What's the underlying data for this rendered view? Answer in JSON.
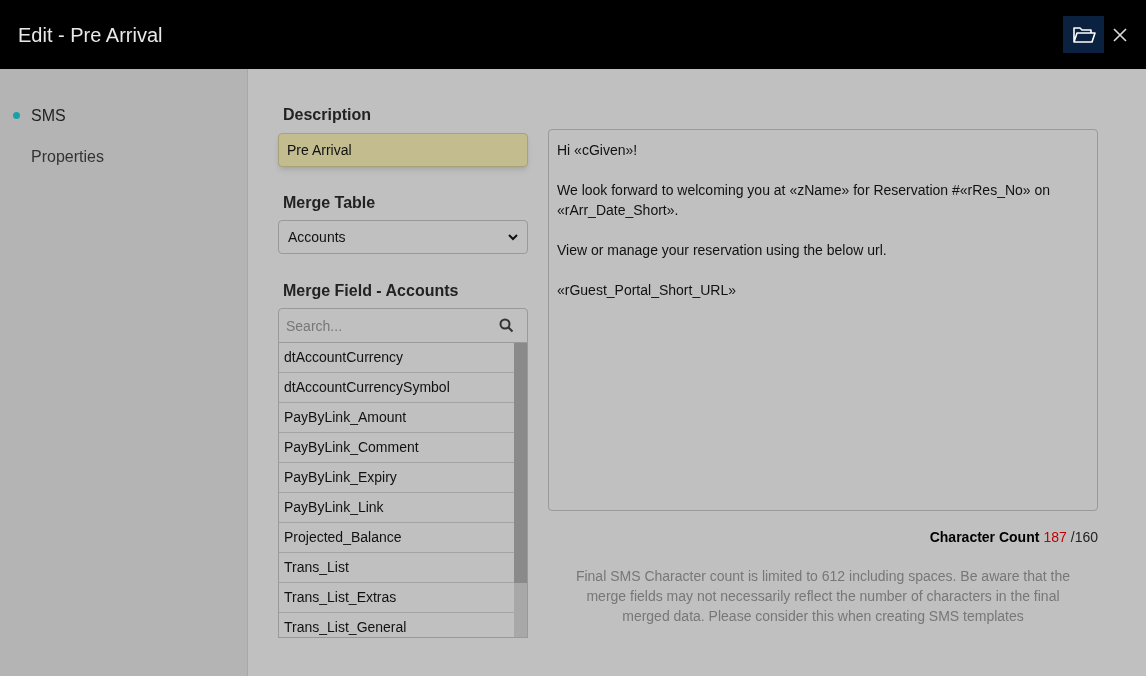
{
  "window": {
    "title": "Edit - Pre Arrival"
  },
  "sidebar": {
    "items": [
      {
        "label": "SMS",
        "selected": true
      },
      {
        "label": "Properties",
        "selected": false
      }
    ]
  },
  "description": {
    "label": "Description",
    "value": "Pre Arrival"
  },
  "merge_table": {
    "label": "Merge Table",
    "value": "Accounts"
  },
  "merge_field": {
    "label": "Merge Field - Accounts",
    "search_placeholder": "Search...",
    "items": [
      "dtAccountCurrency",
      "dtAccountCurrencySymbol",
      "PayByLink_Amount",
      "PayByLink_Comment",
      "PayByLink_Expiry",
      "PayByLink_Link",
      "Projected_Balance",
      "Trans_List",
      "Trans_List_Extras",
      "Trans_List_General"
    ]
  },
  "message": "Hi «cGiven»!\n\nWe look forward to welcoming you at «zName» for Reservation #«rRes_No» on «rArr_Date_Short».\n\nView or manage your reservation using the below url.\n\n«rGuest_Portal_Short_URL»",
  "character_count": {
    "label": "Character Count",
    "count": "187",
    "limit": "/160"
  },
  "note": "Final SMS Character count is limited to 612 including spaces. Be aware that the merge fields may not necessarily reflect the number of characters in the final merged data. Please consider this when creating SMS templates"
}
